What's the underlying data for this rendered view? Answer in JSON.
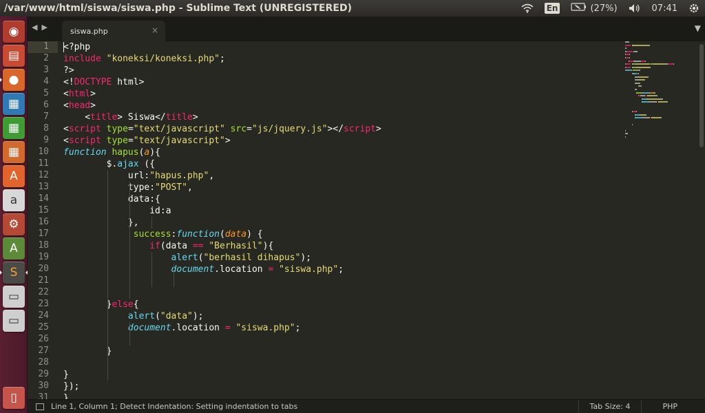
{
  "window": {
    "title": "/var/www/html/siswa/siswa.php - Sublime Text (UNREGISTERED)"
  },
  "panel": {
    "language": "En",
    "battery": "(27%)",
    "time": "07:41",
    "wifi_icon": "wifi-icon",
    "battery_icon": "battery-icon",
    "volume_icon": "volume-icon",
    "gear_icon": "gear-icon"
  },
  "launcher": {
    "items": [
      {
        "name": "dash-home",
        "icon": "ubuntu-logo-icon",
        "color": "#b03c2e"
      },
      {
        "name": "files",
        "icon": "file-manager-icon",
        "color": "#c74a33"
      },
      {
        "name": "firefox",
        "icon": "firefox-icon",
        "color": "#d9662a"
      },
      {
        "name": "libreoffice-writer",
        "icon": "writer-icon",
        "color": "#2f79b5"
      },
      {
        "name": "libreoffice-calc",
        "icon": "calc-icon",
        "color": "#3f9c35"
      },
      {
        "name": "libreoffice-impress",
        "icon": "impress-icon",
        "color": "#d2692d"
      },
      {
        "name": "software-center",
        "icon": "software-center-icon",
        "color": "#e0642c"
      },
      {
        "name": "amazon",
        "icon": "amazon-icon",
        "color": "#d8d8d8"
      },
      {
        "name": "system-settings",
        "icon": "settings-icon",
        "color": "#b44a36"
      },
      {
        "name": "software-updater",
        "icon": "updater-icon",
        "color": "#5b8a38"
      },
      {
        "name": "sublime-text",
        "icon": "sublime-icon",
        "color": "#4a4a46"
      },
      {
        "name": "drive-1",
        "icon": "drive-icon",
        "color": "#cfcfcf"
      },
      {
        "name": "drive-2",
        "icon": "drive-icon",
        "color": "#cfcfcf"
      },
      {
        "name": "trash",
        "icon": "trash-icon",
        "color": "#c5544a"
      }
    ]
  },
  "tabs": [
    {
      "label": "siswa.php",
      "close": "×"
    }
  ],
  "editor": {
    "line_numbers": [
      "1",
      "2",
      "3",
      "4",
      "5",
      "6",
      "7",
      "8",
      "9",
      "10",
      "11",
      "12",
      "13",
      "14",
      "15",
      "16",
      "17",
      "18",
      "19",
      "20",
      "21",
      "22",
      "23",
      "24",
      "25",
      "26",
      "27",
      "28",
      "29",
      "30",
      "31"
    ],
    "lines": [
      [
        [
          "",
          "<?php"
        ]
      ],
      [
        [
          "kw",
          "include"
        ],
        [
          "",
          " "
        ],
        [
          "str",
          "\"koneksi/koneksi.php\""
        ],
        [
          "",
          ";"
        ]
      ],
      [
        [
          "",
          "?>"
        ]
      ],
      [
        [
          "",
          "<!"
        ],
        [
          "tag",
          "DOCTYPE"
        ],
        [
          "",
          " html>"
        ]
      ],
      [
        [
          "",
          "<"
        ],
        [
          "tag",
          "html"
        ],
        [
          "",
          ">"
        ]
      ],
      [
        [
          "",
          "<"
        ],
        [
          "tag",
          "head"
        ],
        [
          "",
          ">"
        ]
      ],
      [
        [
          "",
          "    <"
        ],
        [
          "tag",
          "title"
        ],
        [
          "",
          "> Siswa</"
        ],
        [
          "tag",
          "title"
        ],
        [
          "",
          ">"
        ]
      ],
      [
        [
          "",
          "<"
        ],
        [
          "tag",
          "script"
        ],
        [
          "",
          " "
        ],
        [
          "attr",
          "type"
        ],
        [
          "",
          "="
        ],
        [
          "str",
          "\"text/javascript\""
        ],
        [
          "",
          " "
        ],
        [
          "attr",
          "src"
        ],
        [
          "",
          "="
        ],
        [
          "str",
          "\"js/jquery.js\""
        ],
        [
          "",
          "></"
        ],
        [
          "tag",
          "script"
        ],
        [
          "",
          ">"
        ]
      ],
      [
        [
          "",
          "<"
        ],
        [
          "tag",
          "script"
        ],
        [
          "",
          " "
        ],
        [
          "attr",
          "type"
        ],
        [
          "",
          "="
        ],
        [
          "str",
          "\"text/javascript\""
        ],
        [
          "",
          ">"
        ]
      ],
      [
        [
          "func",
          "function"
        ],
        [
          "",
          " "
        ],
        [
          "name",
          "hapus"
        ],
        [
          "",
          "("
        ],
        [
          "param",
          "a"
        ],
        [
          "",
          "){"
        ]
      ],
      [
        [
          "",
          "        $."
        ],
        [
          "call",
          "ajax"
        ],
        [
          "",
          " ({"
        ]
      ],
      [
        [
          "",
          "            url:"
        ],
        [
          "str",
          "\"hapus.php\""
        ],
        [
          "",
          ","
        ]
      ],
      [
        [
          "",
          "            type:"
        ],
        [
          "str",
          "\"POST\""
        ],
        [
          "",
          ","
        ]
      ],
      [
        [
          "",
          "            data:{"
        ]
      ],
      [
        [
          "",
          "                id:a"
        ]
      ],
      [
        [
          "",
          "            },"
        ]
      ],
      [
        [
          "",
          "             "
        ],
        [
          "name",
          "success"
        ],
        [
          "",
          ":"
        ],
        [
          "func",
          "function"
        ],
        [
          "",
          "("
        ],
        [
          "param",
          "data"
        ],
        [
          "",
          ") {"
        ]
      ],
      [
        [
          "",
          "                "
        ],
        [
          "kw",
          "if"
        ],
        [
          "",
          "(data "
        ],
        [
          "op",
          "=="
        ],
        [
          "",
          " "
        ],
        [
          "str",
          "\"Berhasil\""
        ],
        [
          "",
          "){"
        ]
      ],
      [
        [
          "",
          "                    "
        ],
        [
          "call",
          "alert"
        ],
        [
          "",
          "("
        ],
        [
          "str",
          "\"berhasil dihapus\""
        ],
        [
          "",
          ");"
        ]
      ],
      [
        [
          "",
          "                    "
        ],
        [
          "obj",
          "document"
        ],
        [
          "",
          ".location "
        ],
        [
          "op",
          "="
        ],
        [
          "",
          " "
        ],
        [
          "str",
          "\"siswa.php\""
        ],
        [
          "",
          ";"
        ]
      ],
      [
        [
          "",
          ""
        ]
      ],
      [
        [
          "",
          ""
        ]
      ],
      [
        [
          "",
          "        }"
        ],
        [
          "kw",
          "else"
        ],
        [
          "",
          "{"
        ]
      ],
      [
        [
          "",
          "            "
        ],
        [
          "call",
          "alert"
        ],
        [
          "",
          "("
        ],
        [
          "str",
          "\"data\""
        ],
        [
          "",
          ");"
        ]
      ],
      [
        [
          "",
          "            "
        ],
        [
          "obj",
          "document"
        ],
        [
          "",
          ".location "
        ],
        [
          "op",
          "="
        ],
        [
          "",
          " "
        ],
        [
          "str",
          "\"siswa.php\""
        ],
        [
          "",
          ";"
        ]
      ],
      [
        [
          "",
          ""
        ]
      ],
      [
        [
          "",
          "        }"
        ]
      ],
      [
        [
          "",
          ""
        ]
      ],
      [
        [
          "",
          "}"
        ]
      ],
      [
        [
          "",
          "});"
        ]
      ],
      [
        [
          "",
          "}"
        ]
      ]
    ]
  },
  "statusbar": {
    "message": "Line 1, Column 1; Detect Indentation: Setting indentation to tabs",
    "tab_size": "Tab Size: 4",
    "syntax": "PHP"
  },
  "colors": {
    "background": "#272822",
    "tag": "#f92672",
    "string": "#e6db74",
    "function": "#66d9ef",
    "name": "#a6e22e",
    "param": "#fd971f"
  }
}
